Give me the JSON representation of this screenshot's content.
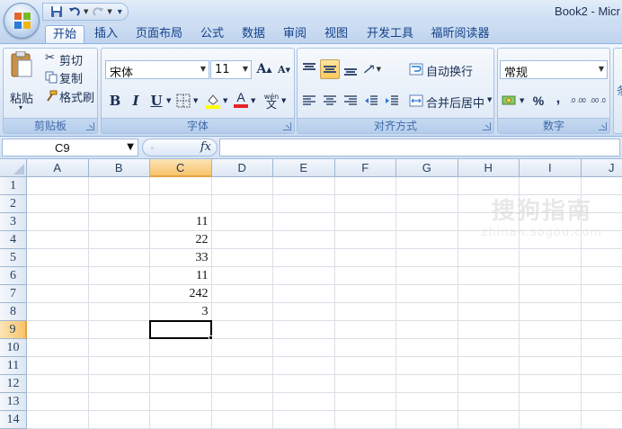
{
  "window": {
    "title": "Book2 - Micr"
  },
  "tabs": [
    "开始",
    "插入",
    "页面布局",
    "公式",
    "数据",
    "审阅",
    "视图",
    "开发工具",
    "福昕阅读器"
  ],
  "ribbon": {
    "clipboard": {
      "paste": "粘贴",
      "cut": "剪切",
      "copy": "复制",
      "format_painter": "格式刷",
      "label": "剪贴板"
    },
    "font": {
      "name": "宋体",
      "size": "11",
      "grow": "A",
      "shrink": "A",
      "bold": "B",
      "italic": "I",
      "underline": "U",
      "font_color": "A",
      "phonetic": "wén",
      "label": "字体"
    },
    "alignment": {
      "wrap": "自动换行",
      "merge": "合并后居中",
      "label": "对齐方式"
    },
    "number": {
      "format": "常规",
      "percent": "%",
      "comma": ",",
      "inc_decimal": ".0 .00",
      "dec_decimal": ".00 .0",
      "label": "数字"
    },
    "next_group_partial": "条"
  },
  "formula_bar": {
    "name_box": "C9",
    "fx": "fx",
    "formula": ""
  },
  "grid": {
    "columns": [
      "A",
      "B",
      "C",
      "D",
      "E",
      "F",
      "G",
      "H",
      "I",
      "J"
    ],
    "rows": [
      "1",
      "2",
      "3",
      "4",
      "5",
      "6",
      "7",
      "8",
      "9",
      "10",
      "11",
      "12",
      "13",
      "14"
    ],
    "selected_column": "C",
    "selected_row": "9",
    "cells": [
      {
        "ref": "C3",
        "value": "11"
      },
      {
        "ref": "C4",
        "value": "22"
      },
      {
        "ref": "C5",
        "value": "33"
      },
      {
        "ref": "C6",
        "value": "11"
      },
      {
        "ref": "C7",
        "value": "242"
      },
      {
        "ref": "C8",
        "value": "3"
      }
    ]
  },
  "watermark": {
    "logo": "搜狗指南",
    "url": "zhinan.sogou.com"
  },
  "colors": {
    "accent": "#15428b",
    "selected_header": "#f7c46c",
    "font_color_bar": "#e8232a",
    "highlight_bar": "#ffff00"
  }
}
